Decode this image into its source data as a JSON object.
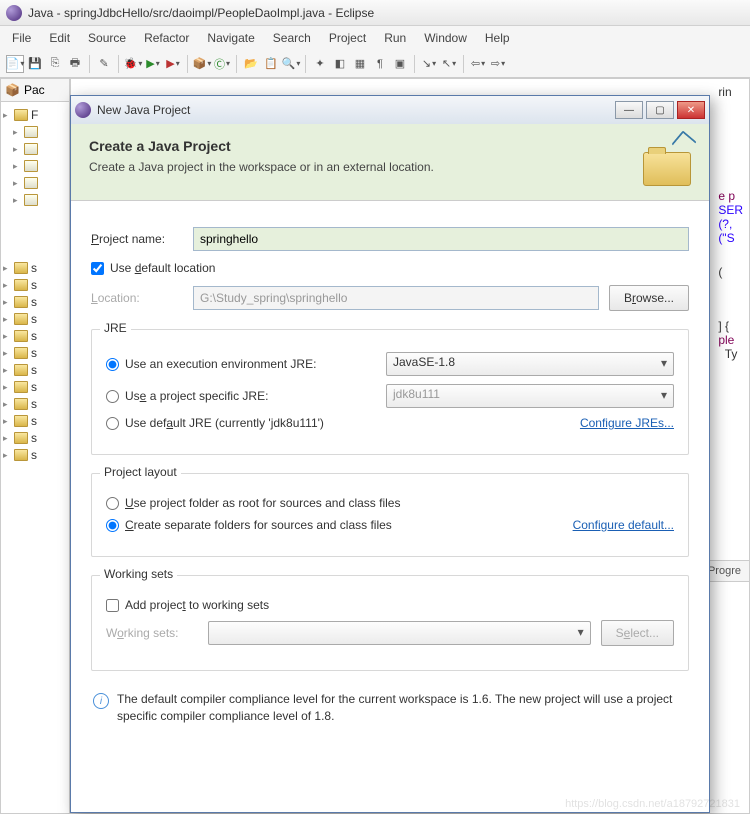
{
  "main_window": {
    "title": "Java - springJdbcHello/src/daoimpl/PeopleDaoImpl.java - Eclipse"
  },
  "menu": {
    "file": "File",
    "edit": "Edit",
    "source": "Source",
    "refactor": "Refactor",
    "navigate": "Navigate",
    "search": "Search",
    "project": "Project",
    "run": "Run",
    "window": "Window",
    "help": "Help"
  },
  "side": {
    "tab_label": "Pac",
    "bottom_tab": "Progre"
  },
  "editor_fragments": {
    "l1": "rin",
    "l2": "e p",
    "l3": "SER",
    "l4": "(?,",
    "l5": "(\"S",
    "l6": "(",
    "l7": "] {",
    "l8": "ple",
    "l9": "  Ty"
  },
  "dialog": {
    "title": "New Java Project",
    "banner_title": "Create a Java Project",
    "banner_desc": "Create a Java project in the workspace or in an external location.",
    "project_name_label": "Project name:",
    "project_name_value": "springhello",
    "use_default_location": "Use default location",
    "location_label": "Location:",
    "location_value": "G:\\Study_spring\\springhello",
    "browse": "Browse...",
    "jre": {
      "legend": "JRE",
      "opt1": "Use an execution environment JRE:",
      "opt1_value": "JavaSE-1.8",
      "opt2": "Use a project specific JRE:",
      "opt2_value": "jdk8u111",
      "opt3": "Use default JRE (currently 'jdk8u111')",
      "link": "Configure JREs..."
    },
    "layout": {
      "legend": "Project layout",
      "opt1": "Use project folder as root for sources and class files",
      "opt2": "Create separate folders for sources and class files",
      "link": "Configure default..."
    },
    "ws": {
      "legend": "Working sets",
      "add": "Add project to working sets",
      "label": "Working sets:",
      "select": "Select..."
    },
    "info": "The default compiler compliance level for the current workspace is 1.6. The new project will use a project specific compiler compliance level of 1.8."
  },
  "watermark": "https://blog.csdn.net/a18792721831"
}
